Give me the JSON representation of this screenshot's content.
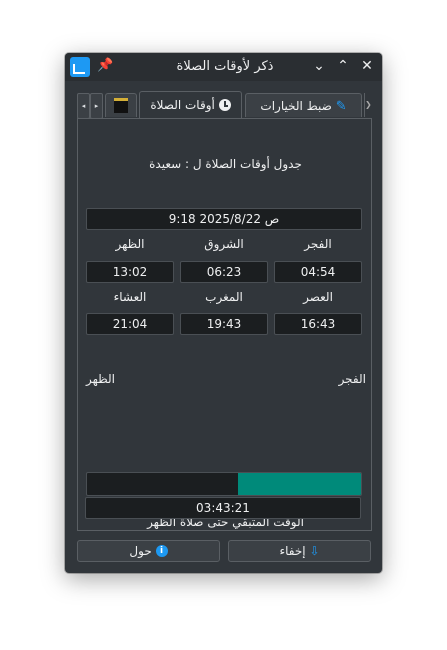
{
  "window": {
    "title": "ذكر لأوقات الصلاة",
    "min_glyph": "⌄",
    "max_glyph": "⌃",
    "close_glyph": "✕",
    "pin_glyph": "📌"
  },
  "tabs": {
    "nav_left": "◂",
    "nav_right": "▸",
    "kaaba_icon": "kaaba-icon",
    "prayer_label": "أوقات الصلاة",
    "settings_label": "ضبط الخيارات",
    "more": "❯"
  },
  "main": {
    "table_caption": "جدول أوقات الصلاة ل : سعيدة",
    "datetime": "9:18 2025/8/22 ص",
    "prayers_row1": [
      {
        "name": "الفجر",
        "time": "04:54"
      },
      {
        "name": "الشروق",
        "time": "06:23"
      },
      {
        "name": "الظهر",
        "time": "13:02"
      }
    ],
    "prayers_row2": [
      {
        "name": "العصر",
        "time": "16:43"
      },
      {
        "name": "المغرب",
        "time": "19:43"
      },
      {
        "name": "العشاء",
        "time": "21:04"
      }
    ],
    "progress": {
      "from_label": "الفجر",
      "to_label": "الظهر",
      "fraction": 0.45,
      "fill_color": "#008a7a"
    },
    "remaining_label": "الوقت المتبقي حتى صلاة الظهر",
    "remaining_time": "03:43:21"
  },
  "buttons": {
    "hide_label": "إخفاء",
    "about_label": "حول",
    "hide_icon": "arrow-down-icon",
    "about_icon": "info-icon"
  },
  "colors": {
    "accent": "#1d99f3",
    "window_bg": "#31363b",
    "field_bg": "#1b1e20"
  }
}
